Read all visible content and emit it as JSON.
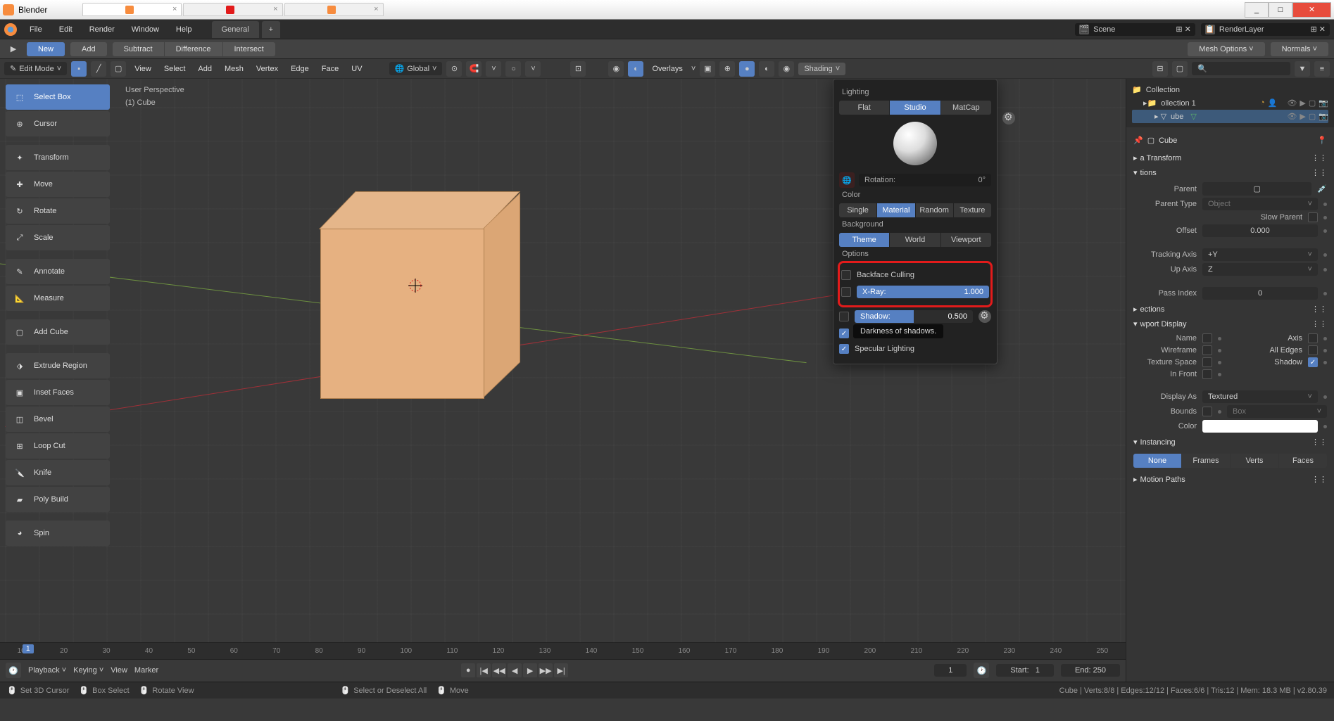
{
  "titlebar": {
    "app": "Blender",
    "tabs": [
      "",
      "",
      ""
    ],
    "win_controls": [
      "_",
      "□",
      "✕"
    ]
  },
  "menu": [
    "File",
    "Edit",
    "Render",
    "Window",
    "Help"
  ],
  "workspaces": {
    "active": "General",
    "add": "+"
  },
  "topbar_right": {
    "scene": "Scene",
    "layer": "RenderLayer"
  },
  "action_bar": {
    "left_icon": "⊞",
    "new": "New",
    "add": "Add",
    "boolean": [
      "Subtract",
      "Difference",
      "Intersect"
    ],
    "right": {
      "mesh_options": "Mesh Options",
      "normals": "Normals"
    }
  },
  "header": {
    "mode": "Edit Mode",
    "menus": [
      "View",
      "Select",
      "Add",
      "Mesh",
      "Vertex",
      "Edge",
      "Face",
      "UV"
    ],
    "orientation": "Global",
    "overlays": "Overlays",
    "shading": "Shading"
  },
  "viewport_info": {
    "line1": "User Perspective",
    "line2": "(1) Cube"
  },
  "tools": {
    "select_box": "Select Box",
    "cursor": "Cursor",
    "transform": "Transform",
    "move": "Move",
    "rotate": "Rotate",
    "scale": "Scale",
    "annotate": "Annotate",
    "measure": "Measure",
    "add_cube": "Add Cube",
    "extrude": "Extrude Region",
    "inset": "Inset Faces",
    "bevel": "Bevel",
    "loop_cut": "Loop Cut",
    "knife": "Knife",
    "poly_build": "Poly Build",
    "spin": "Spin"
  },
  "shading_popover": {
    "title": "Lighting",
    "lighting_modes": [
      "Flat",
      "Studio",
      "MatCap"
    ],
    "rotation_label": "Rotation:",
    "rotation_value": "0°",
    "color_label": "Color",
    "color_modes": [
      "Single",
      "Material",
      "Random",
      "Texture"
    ],
    "bg_label": "Background",
    "bg_modes": [
      "Theme",
      "World",
      "Viewport"
    ],
    "options_label": "Options",
    "backface": "Backface Culling",
    "xray_label": "X-Ray:",
    "xray_value": "1.000",
    "shadow_label": "Shadow:",
    "shadow_value": "0.500",
    "tooltip": "Darkness of shadows.",
    "specular": "Specular Lighting"
  },
  "outliner": {
    "collection": "Collection",
    "collection1": "ollection 1",
    "cube": "ube"
  },
  "properties": {
    "object": "Cube",
    "transform": "a Transform",
    "relations": "tions",
    "parent_label": "Parent",
    "parent_type_label": "Parent Type",
    "parent_type_value": "Object",
    "slow_parent": "Slow Parent",
    "offset_label": "Offset",
    "offset_value": "0.000",
    "tracking_label": "Tracking Axis",
    "tracking_value": "+Y",
    "upaxis_label": "Up Axis",
    "upaxis_value": "Z",
    "passindex_label": "Pass Index",
    "passindex_value": "0",
    "collections": "ections",
    "display": "wport Display",
    "name": "Name",
    "axis": "Axis",
    "wireframe": "Wireframe",
    "alledges": "All Edges",
    "texspace": "Texture Space",
    "shadow": "Shadow",
    "infront": "In Front",
    "displayas_label": "Display As",
    "displayas_value": "Textured",
    "bounds_label": "Bounds",
    "bounds_value": "Box",
    "color_label": "Color",
    "instancing": "Instancing",
    "instancing_modes": [
      "None",
      "Frames",
      "Verts",
      "Faces"
    ],
    "motion_paths": "Motion Paths"
  },
  "timeline": {
    "current": "1",
    "ticks": [
      "10",
      "20",
      "30",
      "40",
      "50",
      "60",
      "70",
      "80",
      "90",
      "100",
      "110",
      "120",
      "130",
      "140",
      "150",
      "160",
      "170",
      "180",
      "190",
      "200",
      "210",
      "220",
      "230",
      "240",
      "250"
    ],
    "menus": [
      "Playback",
      "Keying",
      "View",
      "Marker"
    ],
    "frame": "1",
    "start_label": "Start:",
    "start": "1",
    "end_label": "End:",
    "end": "250"
  },
  "status": {
    "cursor": "Set 3D Cursor",
    "box": "Box Select",
    "rotate": "Rotate View",
    "select": "Select or Deselect All",
    "move": "Move",
    "right": "Cube | Verts:8/8 | Edges:12/12 | Faces:6/6 | Tris:12 | Mem: 18.3 MB | v2.80.39"
  }
}
